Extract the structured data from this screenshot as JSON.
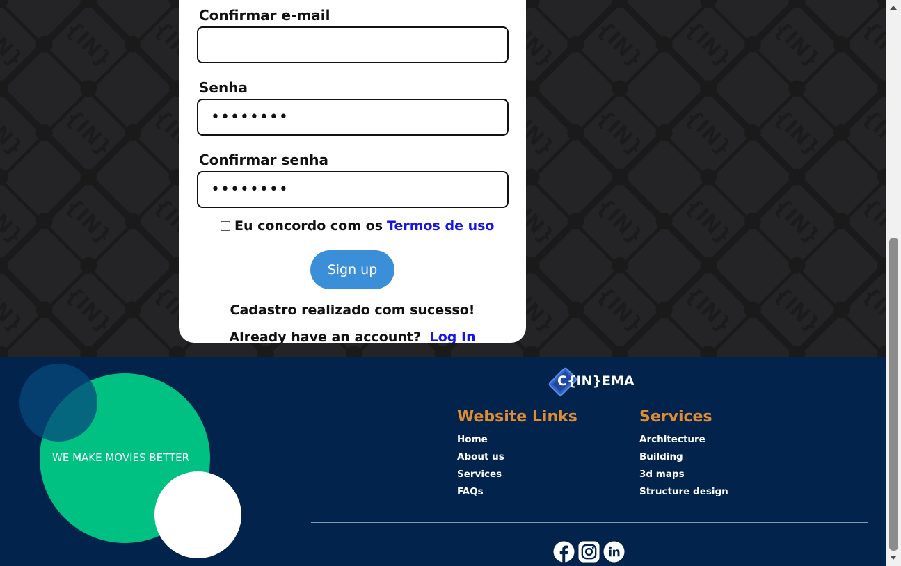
{
  "form": {
    "confirm_email_label": "Confirmar e-mail",
    "confirm_email_value": "",
    "password_label": "Senha",
    "password_value": "••••••••",
    "confirm_password_label": "Confirmar senha",
    "confirm_password_value": "••••••••",
    "terms_text": "Eu concordo com os",
    "terms_link": "Termos de uso",
    "terms_checked": false,
    "signup_label": "Sign up",
    "success_message": "Cadastro realizado com sucesso!",
    "already_text": "Already have an account?",
    "login_link": "Log In"
  },
  "footer": {
    "slogan": "WE MAKE MOVIES BETTER",
    "logo_text": "C{IN}EMA",
    "website_links": {
      "title": "Website Links",
      "items": [
        "Home",
        "About us",
        "Services",
        "FAQs"
      ]
    },
    "services": {
      "title": "Services",
      "items": [
        "Architecture",
        "Building",
        "3d maps",
        "Structure design"
      ]
    },
    "social_icons": [
      "facebook-icon",
      "instagram-icon",
      "linkedin-icon"
    ]
  },
  "colors": {
    "footer_bg": "#02234c",
    "accent_orange": "#e08c33",
    "green_circle": "#00c082",
    "button_blue": "#3b8fd9",
    "link_blue": "#1515e6"
  }
}
